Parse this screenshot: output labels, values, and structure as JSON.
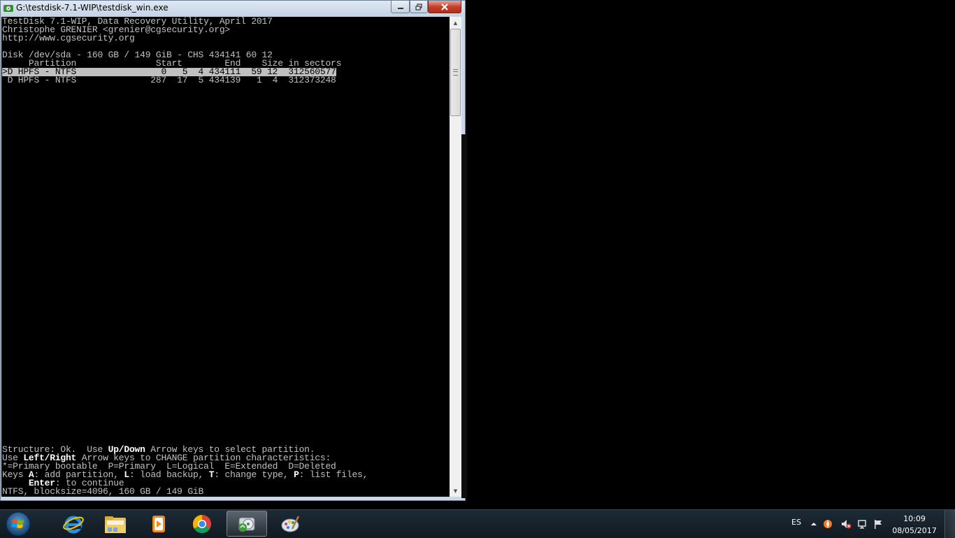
{
  "window": {
    "title": "G:\\testdisk-7.1-WIP\\testdisk_win.exe"
  },
  "terminal": {
    "header": [
      "TestDisk 7.1-WIP, Data Recovery Utility, April 2017",
      "Christophe GRENIER <grenier@cgsecurity.org>",
      "http://www.cgsecurity.org"
    ],
    "disk_info": "Disk /dev/sda - 160 GB / 149 GiB - CHS 434141 60 12",
    "column_header": "     Partition               Start        End    Size in sectors",
    "partitions": [
      ">D HPFS - NTFS                0   5  4 434111  59 12  312560577",
      " D HPFS - NTFS              287  17  5 434139   1  4  312373248"
    ],
    "footer": {
      "line1_a": "Structure: Ok.  Use ",
      "line1_key": "Up/Down",
      "line1_b": " Arrow keys to select partition.",
      "line2_a": "Use ",
      "line2_key": "Left/Right",
      "line2_b": " Arrow keys to CHANGE partition characteristics:",
      "line3": "*=Primary bootable  P=Primary  L=Logical  E=Extended  D=Deleted",
      "line4_a": "Keys ",
      "line4_k1": "A",
      "line4_b": ": add partition, ",
      "line4_k2": "L",
      "line4_c": ": load backup, ",
      "line4_k3": "T",
      "line4_d": ": change type, ",
      "line4_k4": "P",
      "line4_e": ": list files,",
      "line5_pad": "     ",
      "line5_key": "Enter",
      "line5_b": ": to continue",
      "line6": "NTFS, blocksize=4096, 160 GB / 149 GiB"
    }
  },
  "taskbar": {
    "apps": [
      {
        "name": "internet-explorer",
        "icon": "ie-icon"
      },
      {
        "name": "file-explorer",
        "icon": "folder-icon"
      },
      {
        "name": "media-player",
        "icon": "media-player-icon"
      },
      {
        "name": "chrome",
        "icon": "chrome-icon"
      },
      {
        "name": "testdisk",
        "icon": "testdisk-icon",
        "active": true
      },
      {
        "name": "paint",
        "icon": "paint-icon"
      }
    ],
    "tray": {
      "language": "ES",
      "time": "10:09",
      "date": "08/05/2017"
    }
  },
  "colors": {
    "terminal_bg": "#000000",
    "terminal_fg": "#c0c0c0",
    "selection_bg": "#c0c0c0",
    "taskbar_bg": "#16212b"
  }
}
